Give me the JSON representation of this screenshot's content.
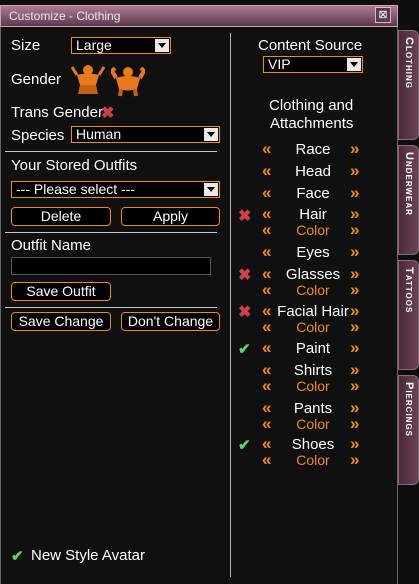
{
  "window": {
    "title": "Customize - Clothing",
    "close_glyph": "⊠"
  },
  "left": {
    "size_label": "Size",
    "size_value": "Large",
    "gender_label": "Gender",
    "trans_gender_label": "Trans Gender",
    "species_label": "Species",
    "species_value": "Human",
    "stored_outfits_label": "Your Stored Outfits",
    "outfit_select_value": "--- Please select ---",
    "delete_label": "Delete",
    "apply_label": "Apply",
    "outfit_name_label": "Outfit Name",
    "outfit_name_value": "",
    "save_outfit_label": "Save Outfit",
    "save_change_label": "Save Change",
    "dont_change_label": "Don't Change",
    "new_style_label": "New Style Avatar"
  },
  "right": {
    "content_source_label": "Content Source",
    "content_source_value": "VIP",
    "clothing_header_line1": "Clothing and",
    "clothing_header_line2": "Attachments",
    "chev_left": "«",
    "chev_right": "»",
    "x_mark": "✖",
    "check_mark": "✔",
    "items": {
      "race": "Race",
      "head": "Head",
      "face": "Face",
      "hair": "Hair",
      "eyes": "Eyes",
      "glasses": "Glasses",
      "facial_hair": "Facial Hair",
      "paint": "Paint",
      "shirts": "Shirts",
      "pants": "Pants",
      "shoes": "Shoes",
      "color": "Color"
    }
  },
  "tabs": [
    "Clothing",
    "Underwear",
    "Tattoos",
    "Piercings"
  ],
  "colors": {
    "accent": "#f08a1a",
    "titlebar": "#8a5a72",
    "check": "#5cd65c",
    "x": "#d0404a"
  }
}
